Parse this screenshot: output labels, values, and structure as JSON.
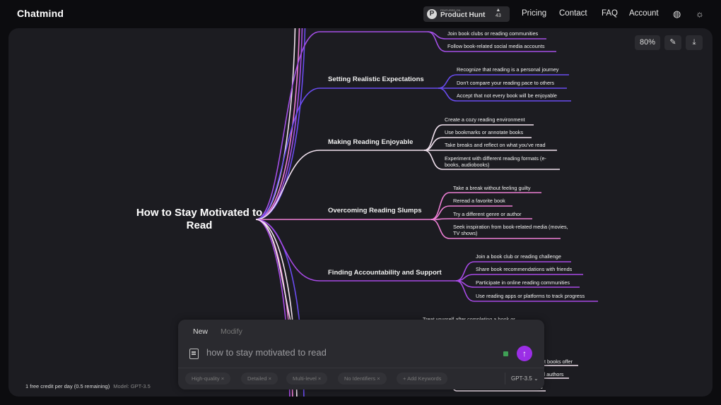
{
  "header": {
    "logo": "Chatmind",
    "product_hunt": {
      "featured": "FEATURED ON",
      "name": "Product Hunt",
      "votes": "43"
    },
    "nav": [
      "Pricing",
      "Contact",
      "FAQ",
      "Account"
    ]
  },
  "toolbar": {
    "zoom": "80%"
  },
  "mindmap": {
    "root": "How to Stay Motivated to Read",
    "colors": {
      "b0": "#a34fe6",
      "b1": "#6a4cf0",
      "b2": "#f3e3f0",
      "b3": "#ee7fd6",
      "b4": "#a84ae6"
    },
    "branches": [
      {
        "label": "",
        "leaves": [
          "Join book clubs or reading communities",
          "Follow book-related social media accounts"
        ]
      },
      {
        "label": "Setting Realistic Expectations",
        "leaves": [
          "Recognize that reading is a personal journey",
          "Don't compare your reading pace to others",
          "Accept that not every book will be enjoyable"
        ]
      },
      {
        "label": "Making Reading Enjoyable",
        "leaves": [
          "Create a cozy reading environment",
          "Use bookmarks or annotate books",
          "Take breaks and reflect on what you've read",
          "Experiment with different reading formats (e-books, audiobooks)"
        ]
      },
      {
        "label": "Overcoming Reading Slumps",
        "leaves": [
          "Take a break without feeling guilty",
          "Reread a favorite book",
          "Try a different genre or author",
          "Seek inspiration from book-related media (movies, TV shows)"
        ]
      },
      {
        "label": "Finding Accountability and Support",
        "leaves": [
          "Join a book club or reading challenge",
          "Share book recommendations with friends",
          "Participate in online reading communities",
          "Use reading apps or platforms to track progress"
        ]
      },
      {
        "label": "",
        "leaves": [
          "Treat yourself after completing a book or",
          "t books offer",
          "d authors",
          "s"
        ]
      }
    ]
  },
  "prompt": {
    "tabs": [
      "New",
      "Modify"
    ],
    "input": "how to stay motivated to read",
    "chips": [
      "High-quality",
      "Detailed",
      "Multi-level",
      "No Identifiers"
    ],
    "add_keywords": "Add Keywords",
    "model": "GPT-3.5"
  },
  "footer": {
    "credits": "1 free credit per day (0.5 remaining)",
    "model": "Model: GPT-3.5"
  }
}
